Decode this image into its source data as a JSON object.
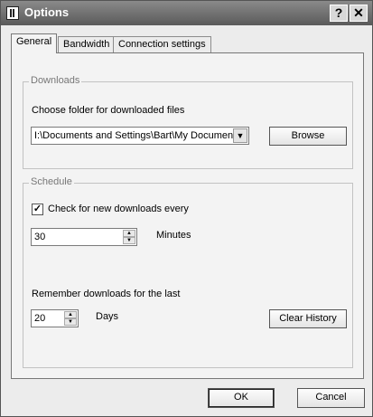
{
  "window": {
    "title": "Options",
    "help_glyph": "?",
    "close_glyph": "✕"
  },
  "tabs": [
    {
      "label": "General"
    },
    {
      "label": "Bandwidth"
    },
    {
      "label": "Connection settings"
    }
  ],
  "downloads": {
    "group_title": "Downloads",
    "folder_label": "Choose folder for downloaded files",
    "folder_value": "I:\\Documents and Settings\\Bart\\My Documents",
    "browse_label": "Browse"
  },
  "schedule": {
    "group_title": "Schedule",
    "check_label": "Check for new downloads every",
    "check_checked": true,
    "check_mark": "✓",
    "interval_value": "30",
    "interval_unit": "Minutes",
    "remember_label": "Remember downloads for the last",
    "remember_value": "20",
    "remember_unit": "Days",
    "clear_history_label": "Clear History"
  },
  "footer": {
    "ok_label": "OK",
    "cancel_label": "Cancel"
  }
}
